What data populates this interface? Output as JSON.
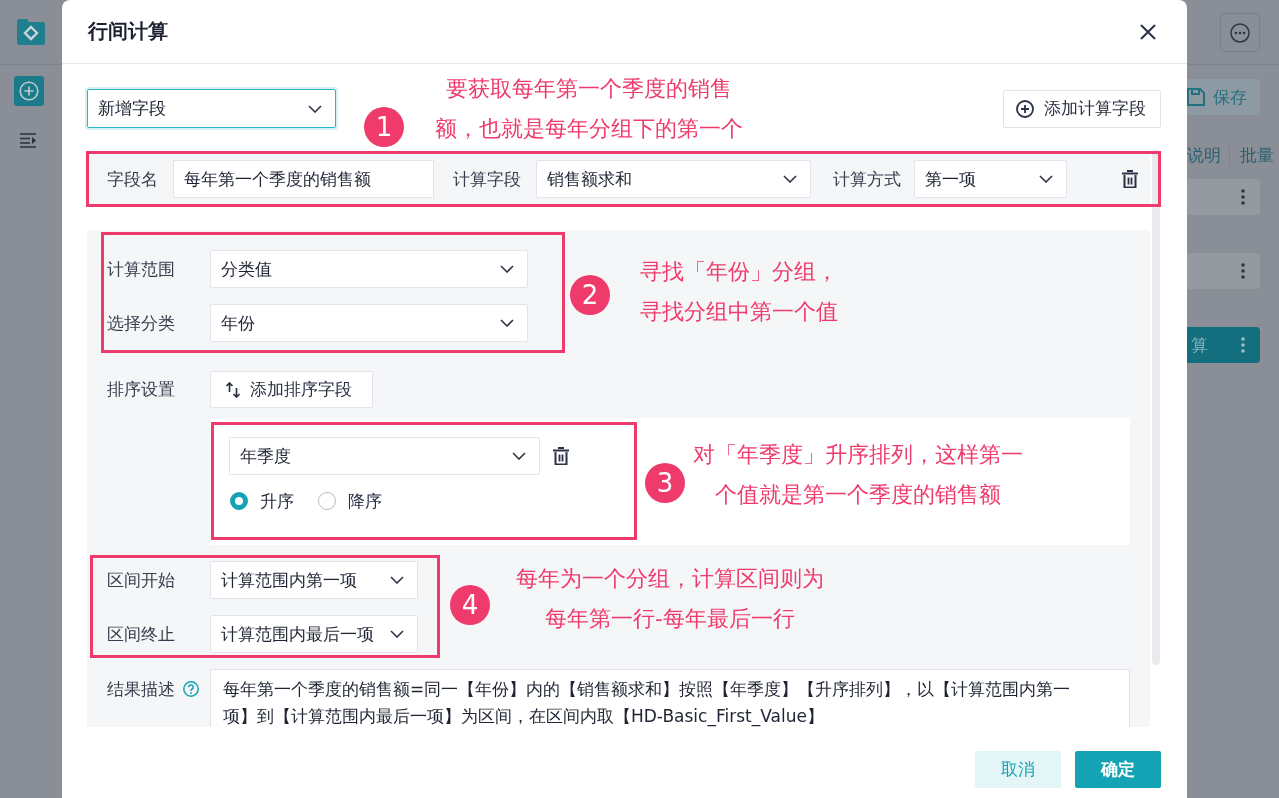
{
  "background": {
    "save_button": "保存",
    "column_headers": [
      "说明",
      "批量"
    ],
    "rows": [
      {
        "selected": false
      },
      {
        "selected": false
      },
      {
        "label": "算",
        "selected": true
      }
    ]
  },
  "dialog": {
    "title": "行间计算",
    "mode_select": {
      "value": "新增字段",
      "focused": true
    },
    "add_field_button": "添加计算字段",
    "field_row": {
      "name": {
        "label": "字段名",
        "value": "每年第一个季度的销售额"
      },
      "calc_field": {
        "label": "计算字段",
        "value": "销售额求和"
      },
      "method": {
        "label": "计算方式",
        "value": "第一项"
      }
    },
    "calc_range": {
      "label": "计算范围",
      "value": "分类值"
    },
    "category": {
      "label": "选择分类",
      "value": "年份"
    },
    "sort": {
      "label": "排序设置",
      "add_button": "添加排序字段",
      "fields": [
        {
          "value": "年季度",
          "orders": [
            {
              "label": "升序",
              "selected": true
            },
            {
              "label": "降序",
              "selected": false
            }
          ]
        }
      ]
    },
    "interval_start": {
      "label": "区间开始",
      "value": "计算范围内第一项"
    },
    "interval_end": {
      "label": "区间终止",
      "value": "计算范围内最后一项"
    },
    "description": {
      "label": "结果描述",
      "value": "每年第一个季度的销售额=同一【年份】内的【销售额求和】按照【年季度】【升序排列】，以【计算范围内第一项】到【计算范围内最后一项】为区间，在区间内取【HD-Basic_First_Value】"
    },
    "buttons": [
      {
        "label": "取消",
        "kind": "secondary"
      },
      {
        "label": "确定",
        "kind": "primary"
      }
    ]
  },
  "annotations": [
    {
      "number": "1",
      "text": "要获取每年第一个季度的销售额，也就是每年分组下的第一个"
    },
    {
      "number": "2",
      "text": "寻找「年份」分组，寻找分组中第一个值"
    },
    {
      "number": "3",
      "text": "对「年季度」升序排列，这样第一个值就是第一个季度的销售额"
    },
    {
      "number": "4",
      "text": "每年为一个分组，计算区间则为每年第一行-每年最后一行"
    }
  ]
}
